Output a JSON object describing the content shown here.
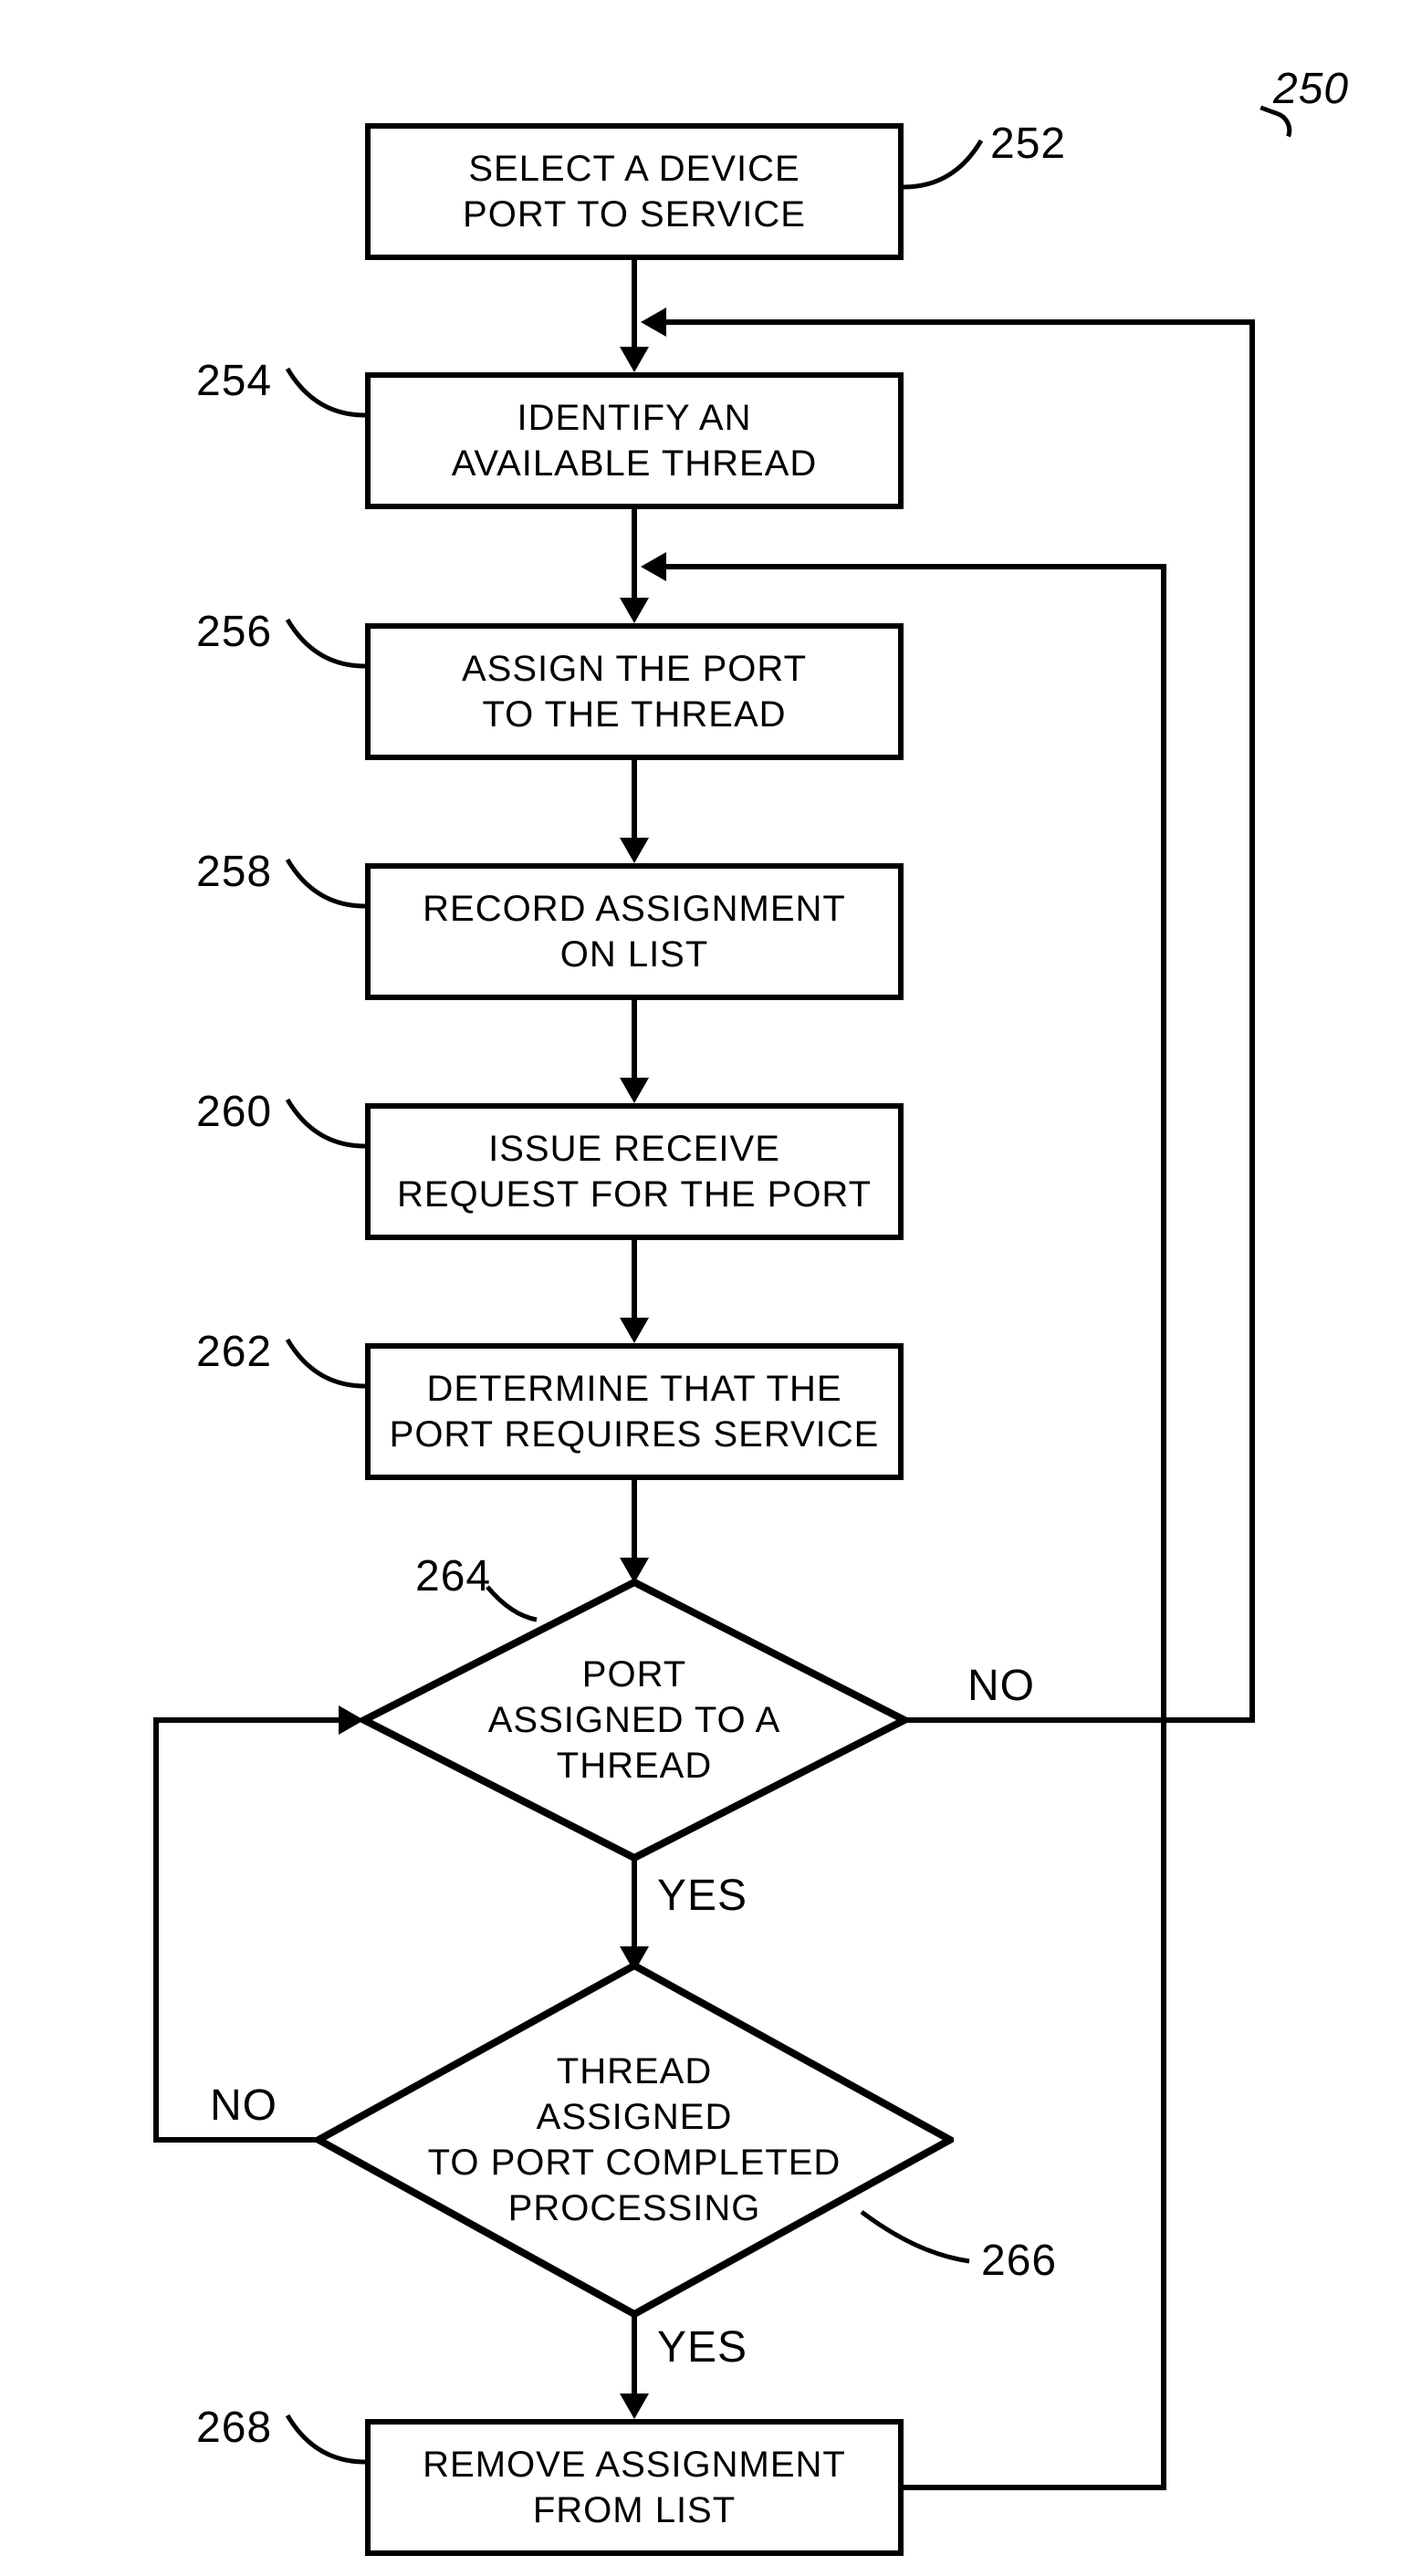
{
  "figure_ref": "250",
  "nodes": {
    "n252": {
      "text": "SELECT A DEVICE\nPORT TO SERVICE",
      "ref": "252"
    },
    "n254": {
      "text": "IDENTIFY AN\nAVAILABLE THREAD",
      "ref": "254"
    },
    "n256": {
      "text": "ASSIGN THE PORT\nTO THE THREAD",
      "ref": "256"
    },
    "n258": {
      "text": "RECORD ASSIGNMENT\nON LIST",
      "ref": "258"
    },
    "n260": {
      "text": "ISSUE RECEIVE\nREQUEST FOR THE  PORT",
      "ref": "260"
    },
    "n262": {
      "text": "DETERMINE THAT THE\nPORT REQUIRES SERVICE",
      "ref": "262"
    },
    "n264": {
      "text": "PORT\nASSIGNED TO A\nTHREAD",
      "ref": "264"
    },
    "n266": {
      "text": "THREAD\nASSIGNED\nTO PORT COMPLETED\nPROCESSING",
      "ref": "266"
    },
    "n268": {
      "text": "REMOVE ASSIGNMENT\nFROM LIST",
      "ref": "268"
    }
  },
  "labels": {
    "no1": "NO",
    "yes1": "YES",
    "no2": "NO",
    "yes2": "YES"
  }
}
